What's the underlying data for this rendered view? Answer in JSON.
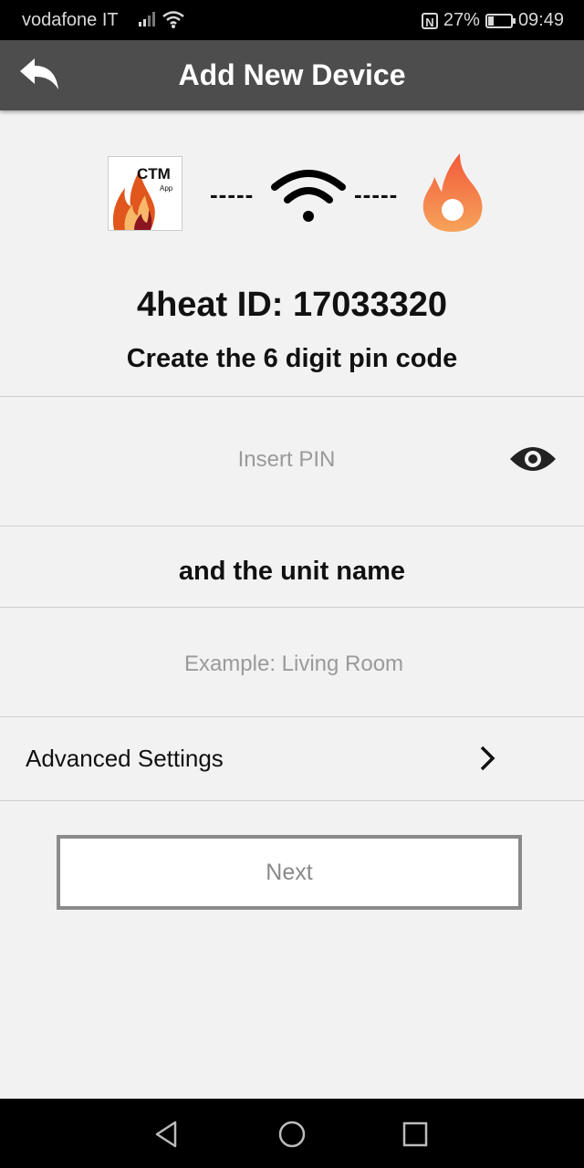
{
  "status_bar": {
    "carrier": "vodafone IT",
    "nfc_icon": "N",
    "battery": "27%",
    "battery_level": 0.27,
    "time": "09:49"
  },
  "app_bar": {
    "title": "Add New Device",
    "back_icon": "back-arrow-icon"
  },
  "graphic": {
    "app_logo_text": "CTM",
    "app_logo_subtext": "App",
    "dashes_left": "-----",
    "dashes_right": "-----",
    "wifi_icon": "wifi-icon",
    "device_icon": "flame-icon"
  },
  "device": {
    "id_text": "4heat ID: 17033320"
  },
  "form": {
    "pin_prompt": "Create the 6 digit pin code",
    "pin_placeholder": "Insert PIN",
    "pin_value": "",
    "unit_prompt": "and the unit name",
    "name_placeholder": "Example: Living Room",
    "name_value": ""
  },
  "advanced": {
    "label": "Advanced Settings"
  },
  "next_button": {
    "label": "Next"
  },
  "colors": {
    "app_bar": "#4d4d4d",
    "background": "#f2f2f2",
    "flame_orange": "#f26a3a",
    "button_border": "#8a8a8a"
  }
}
